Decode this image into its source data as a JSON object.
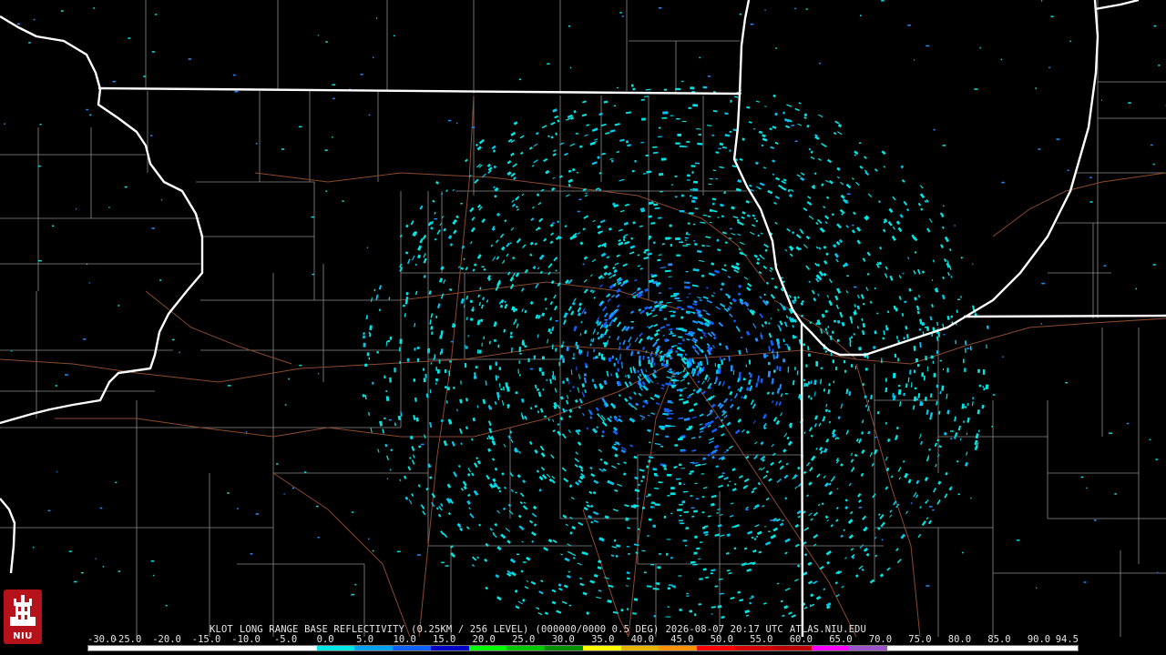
{
  "radar": {
    "station": "KLOT",
    "product": "LONG RANGE BASE REFLECTIVITY",
    "resolution": "(0.25KM / 256 LEVEL)",
    "elevation": "(000000/0000 0.5 DEG)",
    "datetime": "2026-08-07 20:17 UTC",
    "source": "ATLAS.NIU.EDU"
  },
  "logo": {
    "label": "NIU",
    "icon": "niu-tower-icon",
    "color": "#b5121b"
  },
  "colorbar": {
    "ticks": [
      "-30.0",
      "-25.0",
      "-20.0",
      "-15.0",
      "-10.0",
      "-5.0",
      "0.0",
      "5.0",
      "10.0",
      "15.0",
      "20.0",
      "25.0",
      "30.0",
      "35.0",
      "40.0",
      "45.0",
      "50.0",
      "55.0",
      "60.0",
      "65.0",
      "70.0",
      "75.0",
      "80.0",
      "85.0",
      "90.0",
      "94.5"
    ],
    "colors": [
      "#ffffff",
      "#ffffff",
      "#ffffff",
      "#ffffff",
      "#ffffff",
      "#ffffff",
      "#00e5e5",
      "#00a0f0",
      "#1060ff",
      "#0000c8",
      "#00ff00",
      "#00c800",
      "#009000",
      "#ffff00",
      "#e6b400",
      "#ff9000",
      "#ff0000",
      "#d40000",
      "#bc0000",
      "#ff00ff",
      "#9955c9",
      "#ffffff",
      "#ffffff",
      "#ffffff",
      "#ffffff",
      "#ffffff"
    ]
  },
  "map": {
    "background": "#000000",
    "state_border_color": "#ffffff",
    "county_color": "#8c8c8c",
    "road_color": "#8b4a2f",
    "echo_colors": [
      "#00e5e5",
      "#00c8f0",
      "#1e90ff",
      "#1060ff"
    ]
  }
}
